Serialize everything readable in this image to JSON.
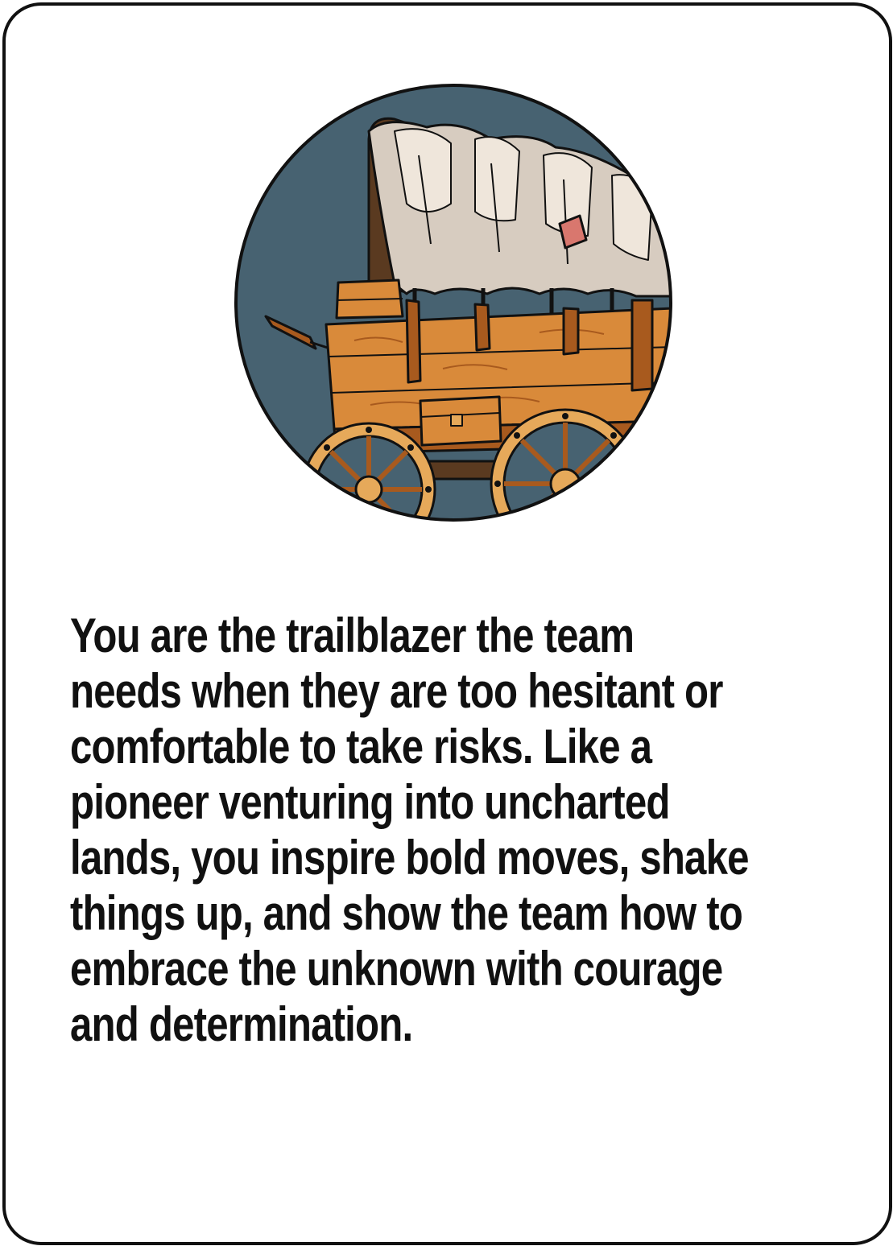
{
  "card": {
    "image": {
      "subject": "covered-wagon-icon",
      "colors": {
        "background": "#476271",
        "wood": "#D98A3A",
        "wood_dark": "#A85A1E",
        "canvas": "#D7CCC0",
        "canvas_light": "#EFE6DB",
        "patch": "#D9776E",
        "wheel": "#E6A95A",
        "outline": "#111111"
      }
    },
    "description_lines": [
      "You are the trailblazer the team",
      "needs when they are too hesitant or",
      "comfortable to take risks. Like a",
      "pioneer venturing into uncharted",
      "lands, you inspire bold moves, shake",
      "things up, and show the team how to",
      "embrace the unknown with courage",
      "and determination."
    ]
  }
}
